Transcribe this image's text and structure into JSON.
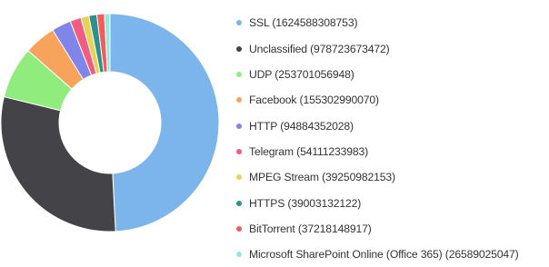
{
  "chart_data": {
    "type": "pie",
    "variant": "donut",
    "legend_position": "right",
    "series": [
      {
        "name": "SSL",
        "value": 1624588308753,
        "label": "SSL (1624588308753)",
        "color": "#7cb5ec"
      },
      {
        "name": "Unclassified",
        "value": 978723673472,
        "label": "Unclassified (978723673472)",
        "color": "#434348"
      },
      {
        "name": "UDP",
        "value": 253701056948,
        "label": "UDP (253701056948)",
        "color": "#90ed7d"
      },
      {
        "name": "Facebook",
        "value": 155302990070,
        "label": "Facebook (155302990070)",
        "color": "#f7a35c"
      },
      {
        "name": "HTTP",
        "value": 94884352028,
        "label": "HTTP (94884352028)",
        "color": "#8085e9"
      },
      {
        "name": "Telegram",
        "value": 54111233983,
        "label": "Telegram (54111233983)",
        "color": "#f15c80"
      },
      {
        "name": "MPEG Stream",
        "value": 39250982153,
        "label": "MPEG Stream (39250982153)",
        "color": "#e4d354"
      },
      {
        "name": "HTTPS",
        "value": 39003132122,
        "label": "HTTPS (39003132122)",
        "color": "#2b908f"
      },
      {
        "name": "BitTorrent",
        "value": 37218148917,
        "label": "BitTorrent (37218148917)",
        "color": "#f45b5b"
      },
      {
        "name": "Microsoft SharePoint Online (Office 365)",
        "value": 26589025047,
        "label": "Microsoft SharePoint Online (Office 365) (26589025047)",
        "color": "#91e8e1"
      }
    ]
  }
}
